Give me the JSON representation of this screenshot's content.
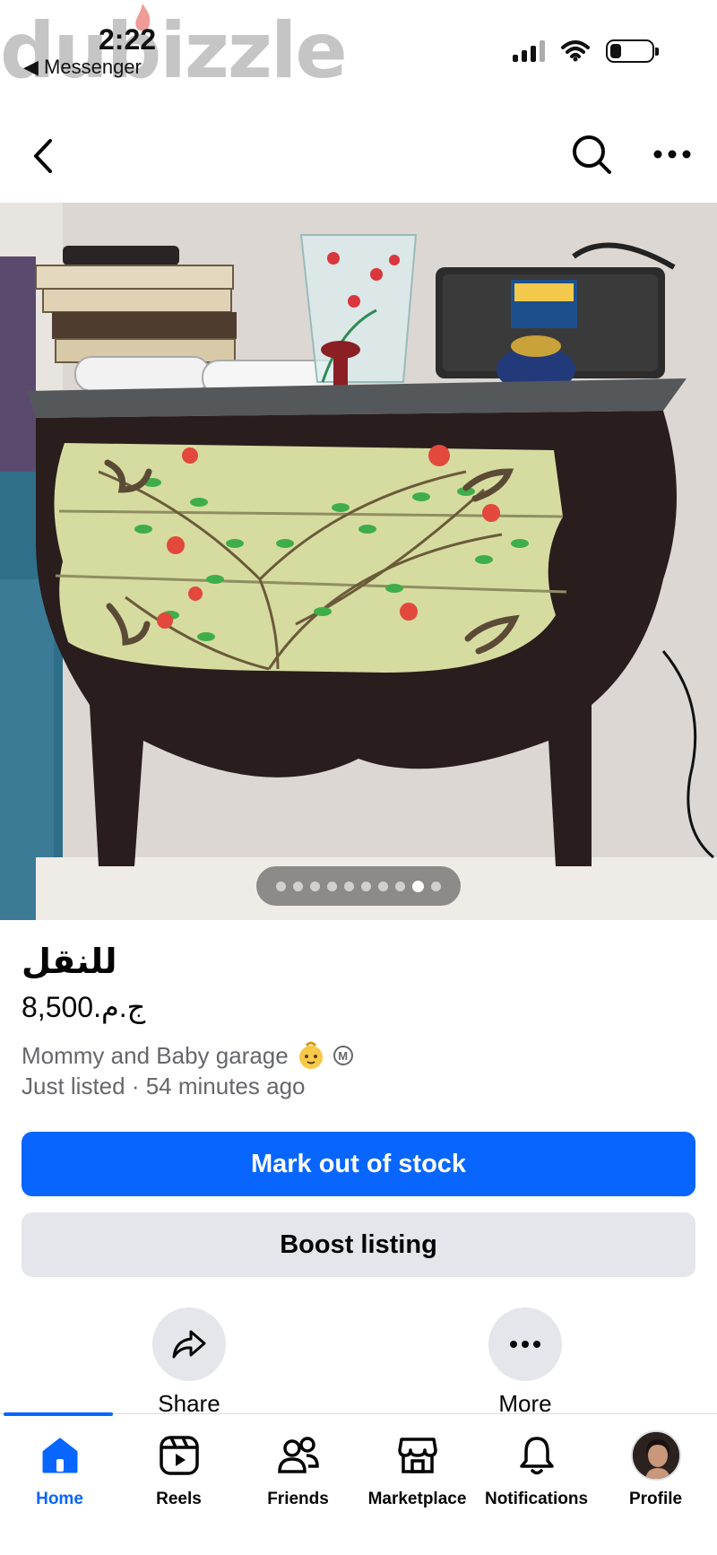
{
  "status_bar": {
    "watermark": "dubizzle",
    "time": "2:22",
    "back_app": "◀ Messenger"
  },
  "listing": {
    "title": "للنقل",
    "price": "ج.م.8,500",
    "seller": "Mommy and Baby garage",
    "listed": "Just listed · 54 minutes ago",
    "photo_count": 10,
    "photo_active_index": 8
  },
  "buttons": {
    "mark_out_of_stock": "Mark out of stock",
    "boost_listing": "Boost listing"
  },
  "actions": {
    "share": "Share",
    "more": "More"
  },
  "tabbar": {
    "home": "Home",
    "reels": "Reels",
    "friends": "Friends",
    "marketplace": "Marketplace",
    "notifications": "Notifications",
    "profile": "Profile"
  },
  "colors": {
    "accent": "#0866ff",
    "secondary_button": "#e4e6eb",
    "muted_text": "#65676b"
  }
}
